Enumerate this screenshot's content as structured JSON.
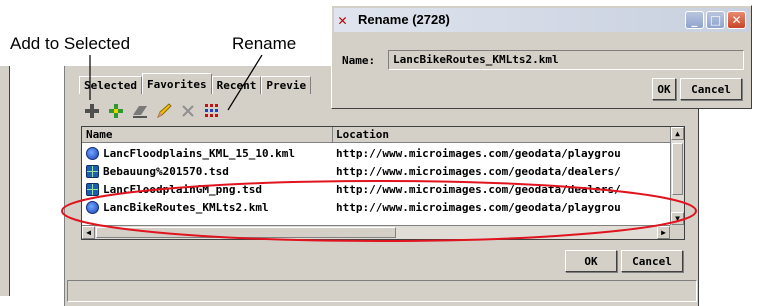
{
  "callouts": {
    "add_to_selected": "Add to Selected",
    "rename": "Rename"
  },
  "main_window": {
    "tabs": [
      "Selected",
      "Favorites",
      "Recent",
      "Previe"
    ],
    "active_tab": "Favorites",
    "toolbar_icons": [
      "add-icon",
      "add-to-selected-icon",
      "group-icon",
      "rename-icon",
      "delete-icon",
      "grid-icon"
    ],
    "columns": {
      "name": "Name",
      "location": "Location"
    },
    "rows": [
      {
        "icon": "globe-icon",
        "name": "LancFloodplains_KML_15_10.kml",
        "location": "http://www.microimages.com/geodata/playgrou"
      },
      {
        "icon": "tsd-icon",
        "name": "Bebauung%201570.tsd",
        "location": "http://www.microimages.com/geodata/dealers/"
      },
      {
        "icon": "tsd-icon",
        "name": "LancFloodplainGM_png.tsd",
        "location": "http://www.microimages.com/geodata/dealers/"
      },
      {
        "icon": "globe-icon",
        "name": "LancBikeRoutes_KMLts2.kml",
        "location": "http://www.microimages.com/geodata/playgrou"
      }
    ],
    "ok_label": "OK",
    "cancel_label": "Cancel"
  },
  "rename_dialog": {
    "title": "Rename (2728)",
    "name_label": "Name:",
    "name_value": "LancBikeRoutes_KMLts2.kml",
    "ok_label": "OK",
    "cancel_label": "Cancel"
  },
  "colors": {
    "highlight_ellipse": "#e0141e",
    "callout_line": "#000000",
    "window_bg": "#d4d0c8"
  }
}
